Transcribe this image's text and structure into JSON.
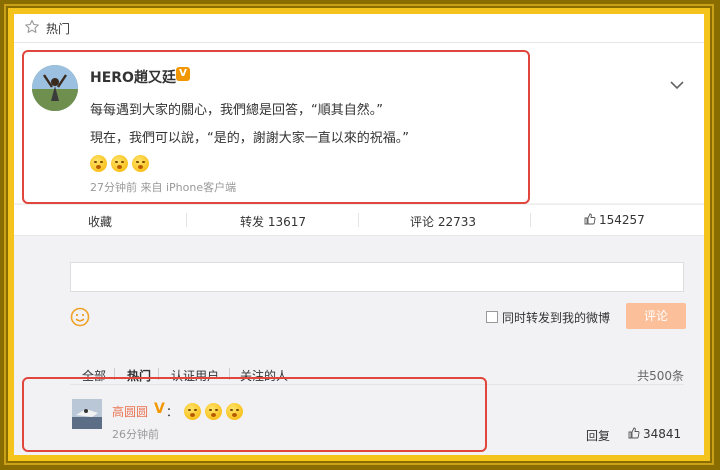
{
  "topbar": {
    "label": "热门",
    "icon": "star-icon"
  },
  "post": {
    "author": "HERO趙又廷",
    "verified_badge": "V",
    "line1": "每每遇到大家的關心，我們總是回答，“順其自然。”",
    "line2": "現在，我們可以說，“是的，謝謝大家一直以來的祝福。”",
    "emoji_count": 3,
    "meta": "27分钟前 来自 iPhone客户端"
  },
  "actions": {
    "favorite": "收藏",
    "repost": "转发 13617",
    "comment": "评论 22733",
    "like": "154257"
  },
  "compose": {
    "input_value": "",
    "sync_label": "同时转发到我的微博",
    "submit_label": "评论"
  },
  "filters": {
    "tabs": [
      "全部",
      "热门",
      "认证用户",
      "关注的人"
    ],
    "active": "热门",
    "total": "共500条"
  },
  "comment": {
    "user": "高圆圆",
    "verified": "V",
    "colon": "：",
    "emoji_count": 3,
    "time": "26分钟前",
    "reply": "回复",
    "likes": "34841"
  },
  "colors": {
    "accent_orange": "#eb7350",
    "verified_gold": "#f29700",
    "highlight_red": "#e0463c",
    "frame_gold": "#f4c31c"
  }
}
